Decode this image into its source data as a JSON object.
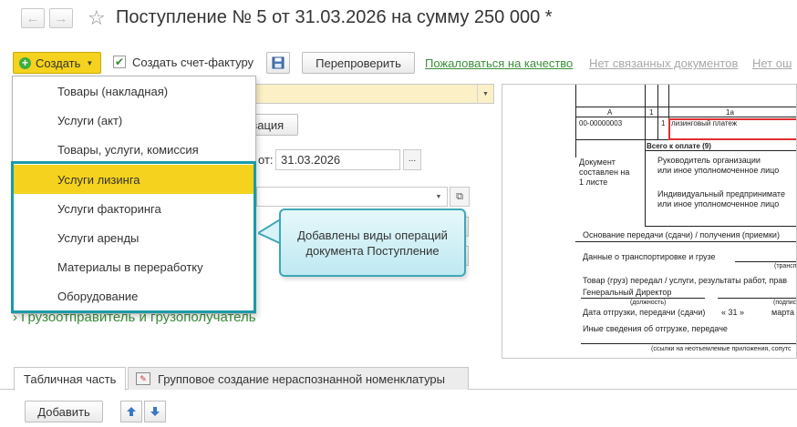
{
  "header": {
    "back_arrow": "←",
    "forward_arrow": "→",
    "star": "☆",
    "title": "Поступление № 5 от 31.03.2026 на сумму 250 000 *"
  },
  "toolbar": {
    "create_label": "Создать",
    "create_invoice_label": "Создать счет-фактуру",
    "create_invoice_checked": true,
    "recheck_label": "Перепроверить",
    "quality_link": "Пожаловаться на качество",
    "no_related_link": "Нет связанных документов",
    "no_link_truncated": "Нет ош"
  },
  "form": {
    "org_button_fragment": "изация",
    "from_label_fragment": "от:",
    "date_value": "31.03.2026",
    "date_button": "...",
    "section_link": "Грузоотправитель и грузополучатель"
  },
  "create_menu": {
    "items": [
      {
        "label": "Товары (накладная)",
        "active": false
      },
      {
        "label": "Услуги (акт)",
        "active": false
      },
      {
        "label": "Товары, услуги, комиссия",
        "active": false
      },
      {
        "label": "Услуги лизинга",
        "active": true
      },
      {
        "label": "Услуги факторинга",
        "active": false
      },
      {
        "label": "Услуги аренды",
        "active": false
      },
      {
        "label": "Материалы в переработку",
        "active": false
      },
      {
        "label": "Оборудование",
        "active": false
      }
    ]
  },
  "callout": {
    "text": "Добавлены виды операций документа Поступление"
  },
  "preview": {
    "col_a": "А",
    "col_1": "1",
    "col_1a": "1а",
    "row_code": "00-00000003",
    "row_num": "1",
    "row_service": "лизинговый платеж",
    "total_label": "Всего к оплате (9)",
    "doc_composed": [
      "Документ",
      "составлен на",
      "1 листе"
    ],
    "head_org": [
      "Руководитель организации",
      "или иное уполномоченное лицо"
    ],
    "indiv": [
      "Индивидуальный предпринимате",
      "или иное уполномоченное лицо"
    ],
    "basis": "Основание передачи (сдачи) / получения (приемки)",
    "transport": "Данные о транспортировке и грузе",
    "transport_hint": "(трансп",
    "goods_line": "Товар (груз) передал / услуги, результаты работ, прав",
    "director": "Генеральный Директор",
    "position_hint": "(должность)",
    "sign_hint": "(подпис",
    "ship_date": "Дата отгрузки, передачи (сдачи)",
    "ship_day": "« 31 »",
    "ship_month": "марта",
    "other_info": "Иные сведения об отгрузке, передаче",
    "other_hint": "(ссылки на неотъемлемые приложения, сопутс"
  },
  "tabs": {
    "tab1": "Табличная часть",
    "tab2": "Групповое создание нераспознанной номенклатуры"
  },
  "table": {
    "add_label": "Добавить",
    "up_arrow": "🡅",
    "down_arrow": "🡇"
  },
  "colors": {
    "accent_yellow": "#f5d21d",
    "link_green": "#3c8f3c",
    "highlight_teal": "#1b9aa8",
    "callout_fill": "#d4f1f6"
  }
}
